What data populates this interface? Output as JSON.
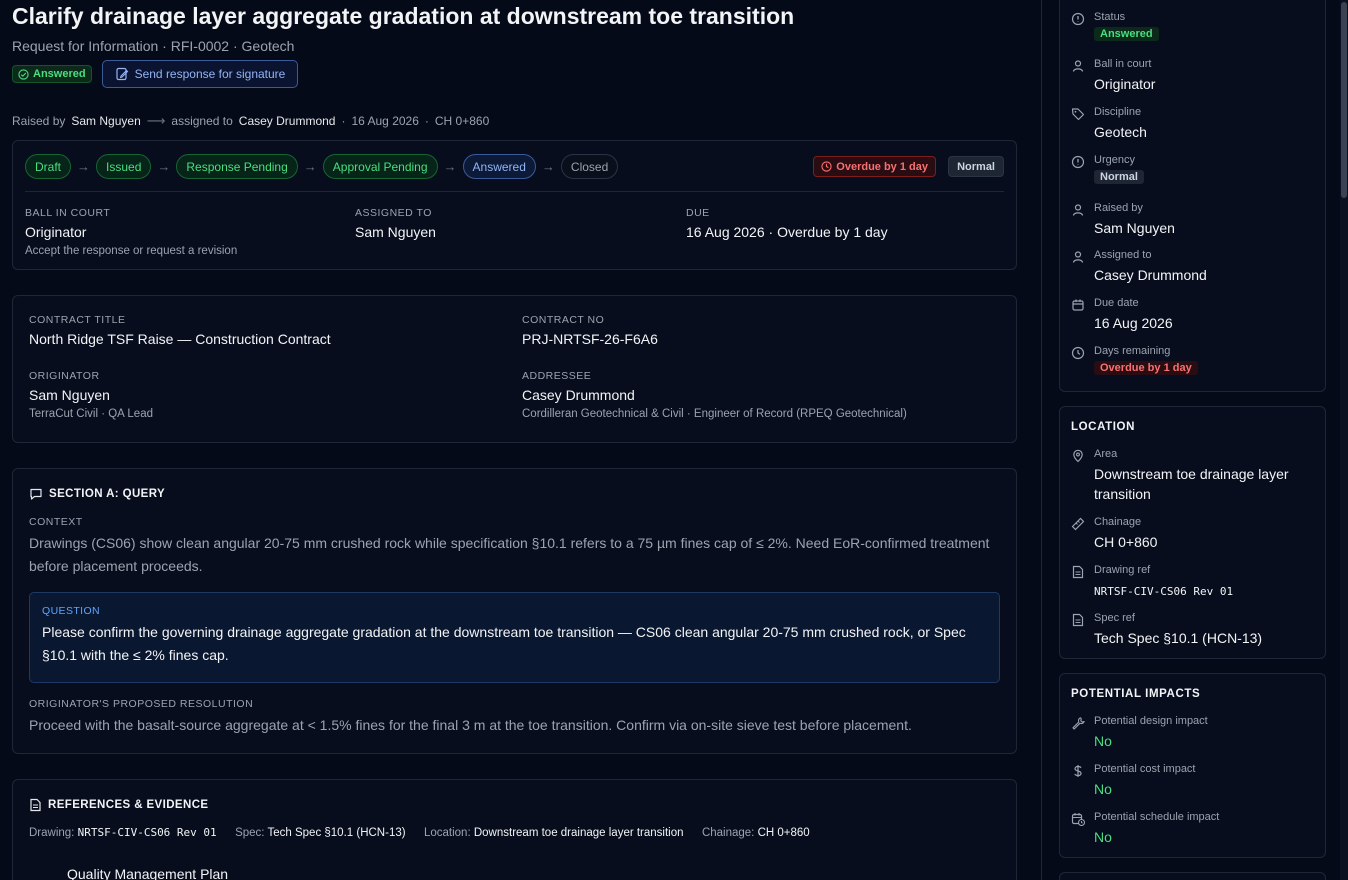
{
  "header": {
    "title": "Clarify drainage layer aggregate gradation at downstream toe transition",
    "subtitle": "Request for Information · RFI-0002 · Geotech",
    "status_badge": "Answered",
    "send_button": "Send response for signature"
  },
  "raised": {
    "raised_by_prefix": "Raised by",
    "raised_by": "Sam Nguyen",
    "assigned_prefix": "assigned to",
    "assigned_to": "Casey Drummond",
    "date": "16 Aug 2026",
    "chainage": "CH 0+860"
  },
  "workflow": {
    "steps": [
      {
        "label": "Draft",
        "state": "done"
      },
      {
        "label": "Issued",
        "state": "done"
      },
      {
        "label": "Response Pending",
        "state": "done"
      },
      {
        "label": "Approval Pending",
        "state": "done"
      },
      {
        "label": "Answered",
        "state": "current"
      },
      {
        "label": "Closed",
        "state": "todo"
      }
    ],
    "overdue": "Overdue by 1 day",
    "priority": "Normal",
    "ball_in_court_label": "Ball in court",
    "ball_in_court": "Originator",
    "ball_in_court_note": "Accept the response or request a revision",
    "assigned_label": "Assigned to",
    "assigned": "Sam Nguyen",
    "due_label": "Due",
    "due": "16 Aug 2026 · Overdue by 1 day"
  },
  "contract": {
    "title_label": "Contract title",
    "title": "North Ridge TSF Raise — Construction Contract",
    "no_label": "Contract no",
    "no": "PRJ-NRTSF-26-F6A6",
    "originator_label": "Originator",
    "originator": "Sam Nguyen",
    "originator_org": "TerraCut Civil · QA Lead",
    "addressee_label": "Addressee",
    "addressee": "Casey Drummond",
    "addressee_org": "Cordilleran Geotechnical & Civil · Engineer of Record (RPEQ Geotechnical)"
  },
  "query": {
    "heading": "SECTION A: QUERY",
    "context_label": "Context",
    "context": "Drawings (CS06) show clean angular 20-75 mm crushed rock while specification §10.1 refers to a 75 µm fines cap of ≤ 2%. Need EoR-confirmed treatment before placement proceeds.",
    "question_label": "QUESTION",
    "question": "Please confirm the governing drainage aggregate gradation at the downstream toe transition — CS06 clean angular 20-75 mm crushed rock, or Spec §10.1 with the ≤ 2% fines cap.",
    "resolution_label": "Originator's proposed resolution",
    "resolution": "Proceed with the basalt-source aggregate at < 1.5% fines for the final 3 m at the toe transition. Confirm via on-site sieve test before placement."
  },
  "references": {
    "heading": "REFERENCES & EVIDENCE",
    "drawing_label": "Drawing:",
    "drawing": "NRTSF-CIV-CS06 Rev 01",
    "spec_label": "Spec:",
    "spec": "Tech Spec §10.1 (HCN-13)",
    "location_label": "Location:",
    "location": "Downstream toe drainage layer transition",
    "chainage_label": "Chainage:",
    "chainage": "CH 0+860",
    "item": "Quality Management Plan"
  },
  "sidebar": {
    "status_label": "Status",
    "status": "Answered",
    "ball_label": "Ball in court",
    "ball": "Originator",
    "discipline_label": "Discipline",
    "discipline": "Geotech",
    "urgency_label": "Urgency",
    "urgency": "Normal",
    "raised_label": "Raised by",
    "raised": "Sam Nguyen",
    "assigned_label": "Assigned to",
    "assigned": "Casey Drummond",
    "due_label": "Due date",
    "due": "16 Aug 2026",
    "days_label": "Days remaining",
    "days": "Overdue by 1 day",
    "location_heading": "LOCATION",
    "area_label": "Area",
    "area": "Downstream toe drainage layer transition",
    "chainage_label": "Chainage",
    "chainage": "CH 0+860",
    "drawing_label": "Drawing ref",
    "drawing": "NRTSF-CIV-CS06 Rev 01",
    "spec_label": "Spec ref",
    "spec": "Tech Spec §10.1 (HCN-13)",
    "impacts_heading": "POTENTIAL IMPACTS",
    "design_label": "Potential design impact",
    "design": "No",
    "cost_label": "Potential cost impact",
    "cost": "No",
    "schedule_label": "Potential schedule impact",
    "schedule": "No"
  }
}
